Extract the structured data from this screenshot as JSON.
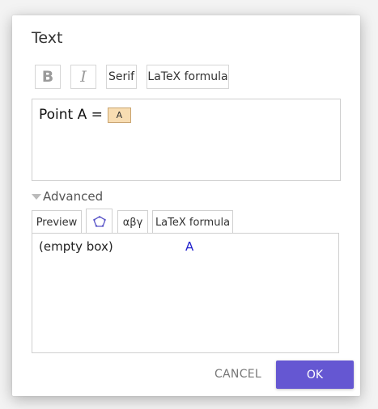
{
  "dialog": {
    "title": "Text",
    "toolbar": {
      "bold_label": "B",
      "italic_label": "I",
      "serif_label": "Serif",
      "latex_label": "LaTeX formula"
    },
    "editor": {
      "text": "Point A =",
      "object_chip": "A"
    },
    "advanced": {
      "label": "Advanced",
      "tabs": [
        {
          "label": "Preview"
        },
        {
          "label": "",
          "icon": "polygon-icon"
        },
        {
          "label": "αβγ"
        },
        {
          "label": "LaTeX formula"
        }
      ],
      "preview": {
        "empty_box": "(empty box)",
        "object": "A"
      }
    },
    "buttons": {
      "cancel": "CANCEL",
      "ok": "OK"
    }
  },
  "colors": {
    "accent": "#6557d2",
    "chip_bg": "#f8ddb2",
    "preview_object": "#2222cc"
  }
}
